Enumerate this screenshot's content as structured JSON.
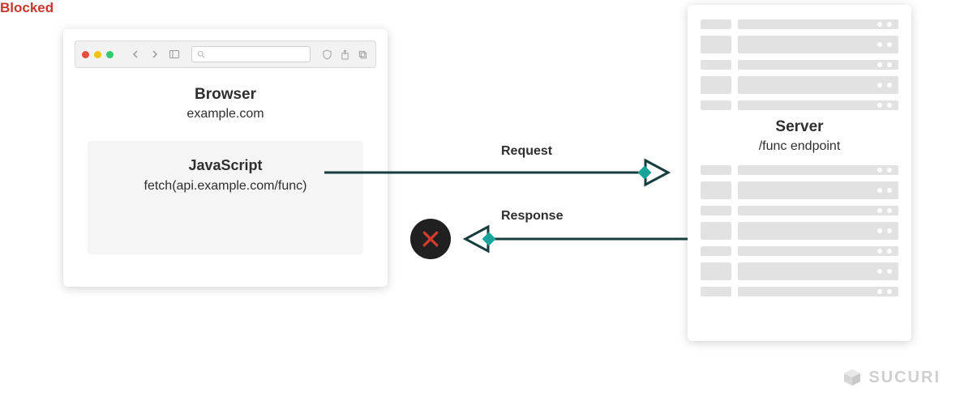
{
  "browser": {
    "title": "Browser",
    "domain": "example.com",
    "js": {
      "title": "JavaScript",
      "code": "fetch(api.example.com/func)"
    }
  },
  "server": {
    "title": "Server",
    "endpoint": "/func endpoint"
  },
  "arrows": {
    "request_label": "Request",
    "response_label": "Response",
    "blocked_label": "Blocked"
  },
  "brand": {
    "name": "SUCURI"
  },
  "colors": {
    "line": "#173d3d",
    "accent": "#1aa39a",
    "blocked_text": "#c8372d",
    "blocked_x": "#d13b2e"
  }
}
